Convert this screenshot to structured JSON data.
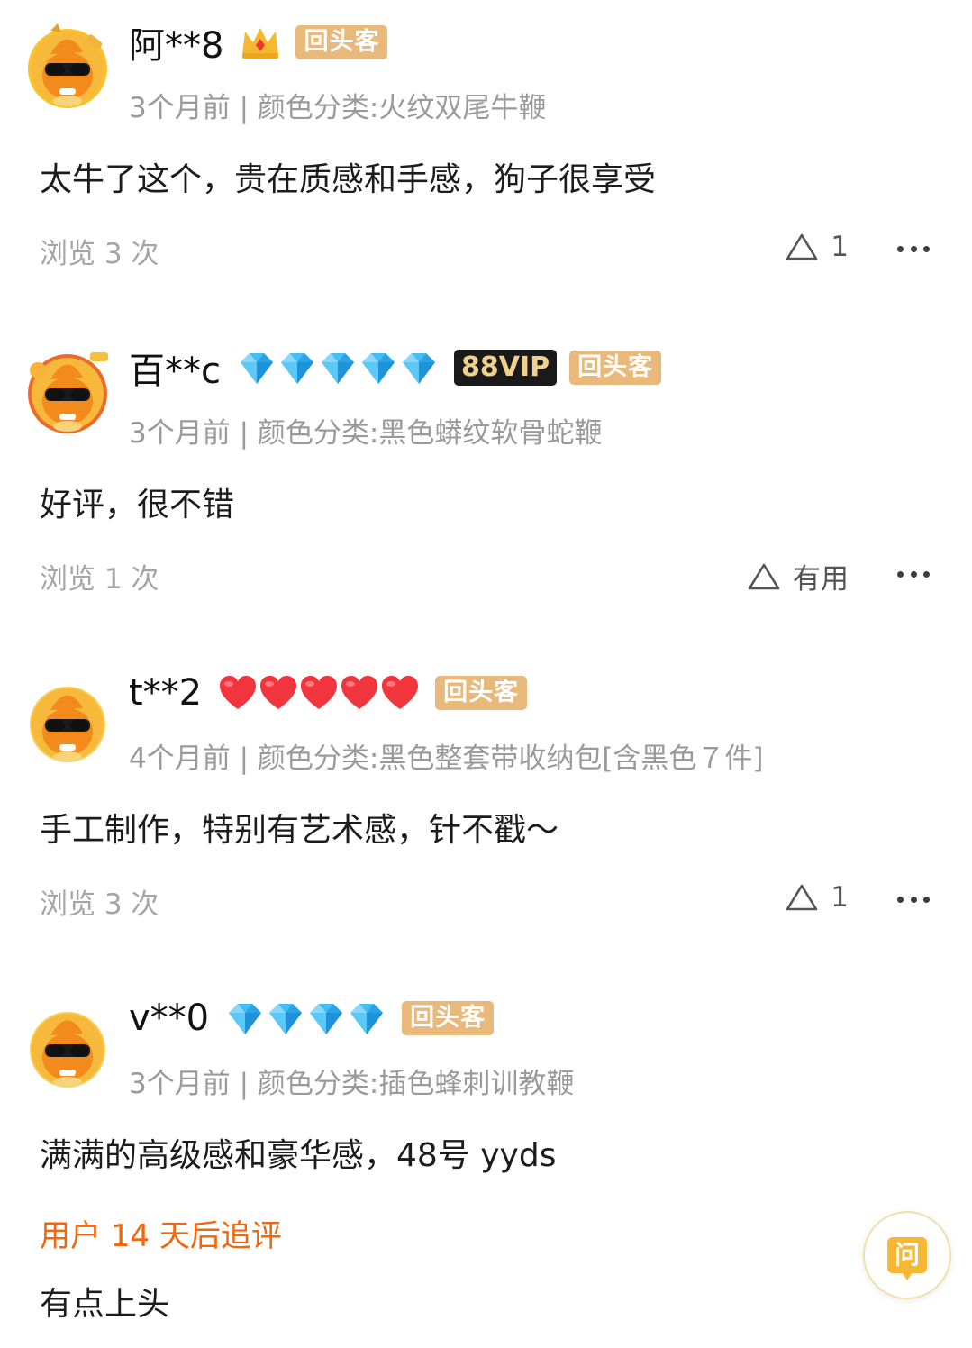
{
  "reviews": [
    {
      "username": "阿**8",
      "badge_tag": "回头客",
      "meta": "3个月前 | 颜色分类:火纹双尾牛鞭",
      "content": "太牛了这个，贵在质感和手感，狗子很享受",
      "views": "浏览 3 次",
      "like_label": "1",
      "level_icon": "crown-icon"
    },
    {
      "username": "百**c",
      "vip_tag": "88VIP",
      "badge_tag": "回头客",
      "meta": "3个月前 | 颜色分类:黑色蟒纹软骨蛇鞭",
      "content": "好评，很不错",
      "views": "浏览 1 次",
      "like_label": "有用",
      "level_icon": "diamond-icon",
      "level_count": 5
    },
    {
      "username": "t**2",
      "badge_tag": "回头客",
      "meta": "4个月前 | 颜色分类:黑色整套带收纳包[含黑色７件]",
      "content": "手工制作，特别有艺术感，针不戳～",
      "views": "浏览 3 次",
      "like_label": "1",
      "level_icon": "heart-icon",
      "level_count": 5
    },
    {
      "username": "v**0",
      "badge_tag": "回头客",
      "meta": "3个月前 | 颜色分类:插色蜂刺训教鞭",
      "content": "满满的高级感和豪华感，48号 yyds",
      "level_icon": "diamond-icon",
      "level_count": 4
    }
  ],
  "followup": {
    "title": "用户 14 天后追评",
    "content": "有点上头"
  },
  "ask_button": {
    "label": "问"
  },
  "colors": {
    "tag_bg": "#e9b87b",
    "followup_accent": "#f5650a",
    "diamond": "#3fb8f2",
    "heart": "#f0353d",
    "ask_icon": "#f7b733"
  }
}
